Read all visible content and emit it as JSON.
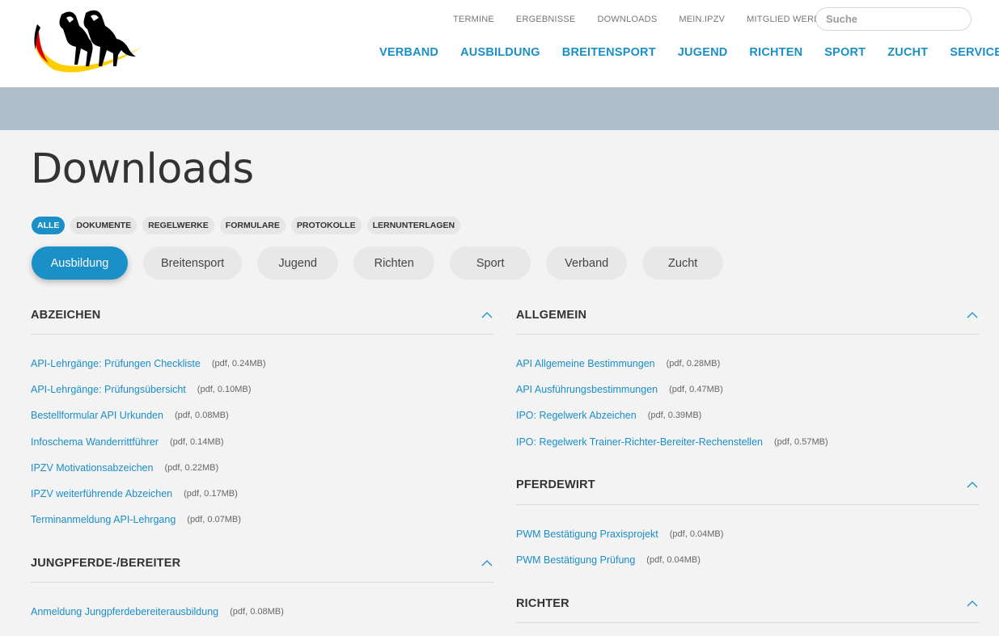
{
  "header": {
    "top_links": [
      "TERMINE",
      "ERGEBNISSE",
      "DOWNLOADS",
      "MEIN.IPZV",
      "MITGLIED WERDEN"
    ],
    "search_placeholder": "Suche",
    "main_nav": [
      "VERBAND",
      "AUSBILDUNG",
      "BREITENSPORT",
      "JUGEND",
      "RICHTEN",
      "SPORT",
      "ZUCHT",
      "SERVICE"
    ],
    "logo_icon": "horses-logo",
    "logo_colors": [
      "#000000",
      "#dd0000",
      "#ffce00"
    ]
  },
  "page": {
    "title": "Downloads"
  },
  "filters": [
    "ALLE",
    "DOKUMENTE",
    "REGELWERKE",
    "FORMULARE",
    "PROTOKOLLE",
    "LERNUNTERLAGEN"
  ],
  "active_filter": "ALLE",
  "categories": [
    "Ausbildung",
    "Breitensport",
    "Jugend",
    "Richten",
    "Sport",
    "Verband",
    "Zucht"
  ],
  "active_category": "Ausbildung",
  "sections_left": [
    {
      "title": "ABZEICHEN",
      "items": [
        {
          "label": "API-Lehrgänge: Prüfungen Checkliste",
          "meta": "(pdf, 0.24MB)"
        },
        {
          "label": "API-Lehrgänge: Prüfungsübersicht",
          "meta": "(pdf, 0.10MB)"
        },
        {
          "label": "Bestellformular API Urkunden",
          "meta": "(pdf, 0.08MB)"
        },
        {
          "label": "Infoschema Wanderrittführer",
          "meta": "(pdf, 0.14MB)"
        },
        {
          "label": "IPZV Motivationsabzeichen",
          "meta": "(pdf, 0.22MB)"
        },
        {
          "label": "IPZV weiterführende Abzeichen",
          "meta": "(pdf, 0.17MB)"
        },
        {
          "label": "Terminanmeldung API-Lehrgang",
          "meta": "(pdf, 0.07MB)"
        }
      ]
    },
    {
      "title": "JUNGPFERDE-/BEREITER",
      "items": [
        {
          "label": "Anmeldung Jungpferdebereiterausbildung",
          "meta": "(pdf, 0.08MB)"
        }
      ]
    }
  ],
  "sections_right": [
    {
      "title": "ALLGEMEIN",
      "items": [
        {
          "label": "API Allgemeine Bestimmungen",
          "meta": "(pdf, 0.28MB)"
        },
        {
          "label": "API Ausführungsbestimmungen",
          "meta": "(pdf, 0.47MB)"
        },
        {
          "label": "IPO: Regelwerk Abzeichen",
          "meta": "(pdf, 0.39MB)"
        },
        {
          "label": "IPO: Regelwerk Trainer-Richter-Bereiter-Rechenstellen",
          "meta": "(pdf, 0.57MB)"
        }
      ]
    },
    {
      "title": "PFERDEWIRT",
      "items": [
        {
          "label": "PWM Bestätigung Praxisprojekt",
          "meta": "(pdf, 0.04MB)"
        },
        {
          "label": "PWM Bestätigung Prüfung",
          "meta": "(pdf, 0.04MB)"
        }
      ]
    },
    {
      "title": "RICHTER",
      "items": []
    }
  ],
  "colors": {
    "accent": "#1a8fc8",
    "banner": "#b0bec9",
    "background": "#f3f3f3"
  }
}
